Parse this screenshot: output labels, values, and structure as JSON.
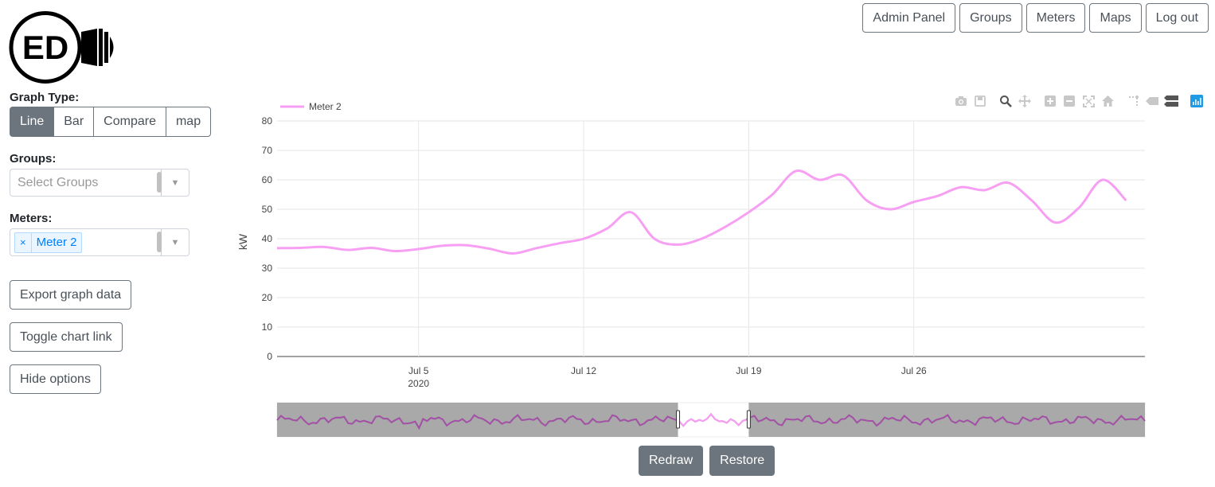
{
  "logo": {
    "text": "ED"
  },
  "nav": [
    {
      "label": "Admin Panel",
      "name": "admin-panel-button"
    },
    {
      "label": "Groups",
      "name": "groups-button"
    },
    {
      "label": "Meters",
      "name": "meters-button"
    },
    {
      "label": "Maps",
      "name": "maps-button"
    },
    {
      "label": "Log out",
      "name": "log-out-button"
    }
  ],
  "sidebar": {
    "graph_type_label": "Graph Type:",
    "graph_types": [
      "Line",
      "Bar",
      "Compare",
      "map"
    ],
    "graph_type_selected": "Line",
    "groups_label": "Groups:",
    "groups_placeholder": "Select Groups",
    "meters_label": "Meters:",
    "meters_selected": [
      "Meter 2"
    ],
    "tag_remove": "×",
    "export_label": "Export graph data",
    "toggle_link_label": "Toggle chart link",
    "hide_options_label": "Hide options"
  },
  "buttons": {
    "redraw": "Redraw",
    "restore": "Restore"
  },
  "colors": {
    "series": "#f79ff3",
    "range_series": "#a44aa7",
    "range_bg": "#9a9a9a",
    "active_tool": "#1f9be6"
  },
  "modebar_icons": [
    "camera-icon",
    "save-icon",
    "zoom-icon",
    "pan-icon",
    "zoom-in-icon",
    "zoom-out-icon",
    "autoscale-icon",
    "reset-axes-icon",
    "spike-lines-icon",
    "hover-closest-icon",
    "hover-compare-icon",
    "plotly-logo-icon"
  ],
  "chart_data": {
    "type": "line",
    "ylabel": "kW",
    "ylim": [
      0,
      80
    ],
    "yticks": [
      0,
      10,
      20,
      30,
      40,
      50,
      60,
      70,
      80
    ],
    "x_range": [
      "2020-06-29",
      "2020-08-01"
    ],
    "xticks": [
      {
        "date": "2020-07-05",
        "label": "Jul 5",
        "sublabel": "2020"
      },
      {
        "date": "2020-07-12",
        "label": "Jul 12",
        "sublabel": ""
      },
      {
        "date": "2020-07-19",
        "label": "Jul 19",
        "sublabel": ""
      },
      {
        "date": "2020-07-26",
        "label": "Jul 26",
        "sublabel": ""
      }
    ],
    "legend_position": "top-left",
    "grid": true,
    "series": [
      {
        "name": "Meter 2",
        "points": [
          [
            "2020-06-29",
            36.8
          ],
          [
            "2020-06-30",
            36.9
          ],
          [
            "2020-07-01",
            37.2
          ],
          [
            "2020-07-02",
            36.2
          ],
          [
            "2020-07-03",
            36.9
          ],
          [
            "2020-07-04",
            35.8
          ],
          [
            "2020-07-05",
            36.5
          ],
          [
            "2020-07-06",
            37.6
          ],
          [
            "2020-07-07",
            37.8
          ],
          [
            "2020-07-08",
            36.6
          ],
          [
            "2020-07-09",
            35.0
          ],
          [
            "2020-07-10",
            36.8
          ],
          [
            "2020-07-11",
            38.5
          ],
          [
            "2020-07-12",
            40.0
          ],
          [
            "2020-07-13",
            43.5
          ],
          [
            "2020-07-14",
            49.0
          ],
          [
            "2020-07-15",
            40.0
          ],
          [
            "2020-07-16",
            38.0
          ],
          [
            "2020-07-17",
            40.0
          ],
          [
            "2020-07-18",
            44.0
          ],
          [
            "2020-07-19",
            49.0
          ],
          [
            "2020-07-20",
            55.0
          ],
          [
            "2020-07-21",
            63.0
          ],
          [
            "2020-07-22",
            60.0
          ],
          [
            "2020-07-23",
            61.5
          ],
          [
            "2020-07-24",
            53.0
          ],
          [
            "2020-07-25",
            50.0
          ],
          [
            "2020-07-26",
            52.5
          ],
          [
            "2020-07-27",
            54.5
          ],
          [
            "2020-07-28",
            57.5
          ],
          [
            "2020-07-29",
            56.5
          ],
          [
            "2020-07-30",
            59.0
          ],
          [
            "2020-07-31",
            53.0
          ],
          [
            "2020-08-01",
            45.5
          ],
          [
            "2020-08-02",
            50.5
          ],
          [
            "2020-08-03",
            60.0
          ],
          [
            "2020-08-04",
            53.0
          ]
        ]
      }
    ],
    "range_selector": {
      "selected_start": "2020-07-16",
      "selected_end": "2020-07-19"
    }
  }
}
